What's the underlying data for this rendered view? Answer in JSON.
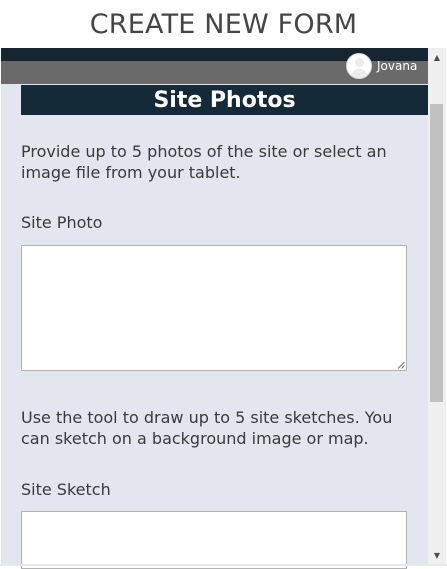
{
  "header": {
    "title": "CREATE NEW FORM"
  },
  "user": {
    "name": "Jovana",
    "avatar_icon": "user-avatar-icon"
  },
  "section": {
    "title": "Site Photos",
    "photo_instructions": "Provide up to 5 photos of the site or select an image file from your tablet.",
    "photo_label": "Site Photo",
    "photo_value": "",
    "sketch_instructions": "Use the tool to draw up to 5 site sketches. You can sketch on a background image or map.",
    "sketch_label": "Site Sketch",
    "sketch_value": ""
  },
  "scrollbar": {
    "up_icon": "▲",
    "down_icon": "▼"
  },
  "colors": {
    "section_header_bg": "#142a38",
    "nav_strip": "#16252f",
    "user_bar": "#6a6a6a",
    "content_bg": "#e3e6ee"
  }
}
